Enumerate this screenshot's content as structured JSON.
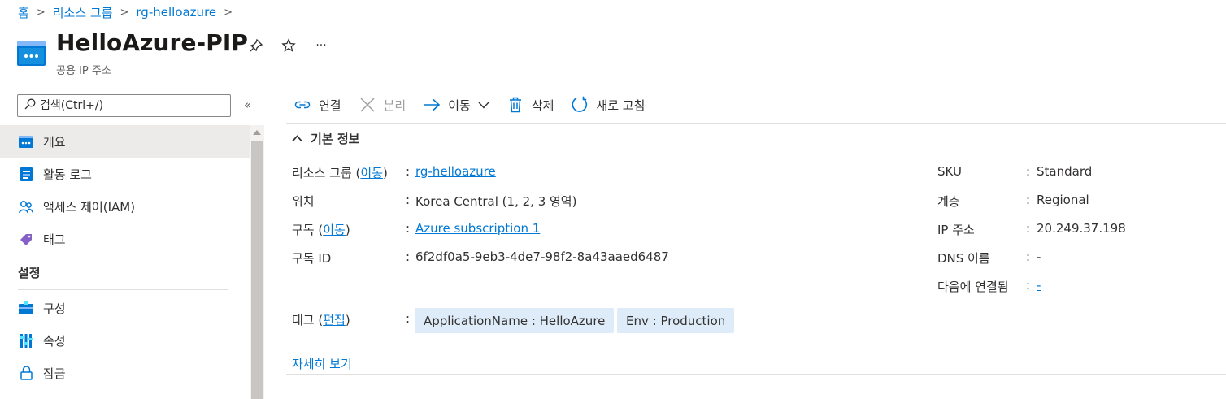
{
  "breadcrumb": [
    {
      "label": "홈"
    },
    {
      "label": "리소스 그룹"
    },
    {
      "label": "rg-helloazure"
    }
  ],
  "header": {
    "title": "HelloAzure-PIP",
    "subtitle": "공용 IP 주소",
    "more_label": "···"
  },
  "sidebar": {
    "search_placeholder": "검색(Ctrl+/)",
    "collapse_label": "«",
    "items": [
      {
        "label": "개요",
        "icon": "overview-icon"
      },
      {
        "label": "활동 로그",
        "icon": "activity-log-icon"
      },
      {
        "label": "액세스 제어(IAM)",
        "icon": "iam-icon"
      },
      {
        "label": "태그",
        "icon": "tag-icon"
      }
    ],
    "section_settings": "설정",
    "settings_items": [
      {
        "label": "구성",
        "icon": "configuration-icon"
      },
      {
        "label": "속성",
        "icon": "properties-icon"
      },
      {
        "label": "잠금",
        "icon": "lock-icon"
      }
    ]
  },
  "toolbar": {
    "associate": "연결",
    "dissociate": "분리",
    "move": "이동",
    "delete": "삭제",
    "refresh": "새로 고침"
  },
  "essentials": {
    "heading": "기본 정보",
    "left": {
      "resource_group": {
        "label": "리소스 그룹",
        "link_paren": "이동",
        "value": "rg-helloazure"
      },
      "location": {
        "label": "위치",
        "value": "Korea Central (1, 2, 3 영역)"
      },
      "subscription": {
        "label": "구독",
        "link_paren": "이동",
        "value": "Azure subscription 1"
      },
      "subscription_id": {
        "label": "구독 ID",
        "value": "6f2df0a5-9eb3-4de7-98f2-8a43aaed6487"
      }
    },
    "right": {
      "sku": {
        "label": "SKU",
        "value": "Standard"
      },
      "tier": {
        "label": "계층",
        "value": "Regional"
      },
      "ip_address": {
        "label": "IP 주소",
        "value": "20.249.37.198"
      },
      "dns_name": {
        "label": "DNS 이름",
        "value": "-"
      },
      "associated_to": {
        "label": "다음에 연결됨",
        "value": "-"
      }
    },
    "tags": {
      "label": "태그",
      "link_paren": "편집",
      "items": [
        "ApplicationName : HelloAzure",
        "Env : Production"
      ]
    },
    "see_more": "자세히 보기"
  },
  "colors": {
    "accent": "#0078d4",
    "tag_bg": "#deecf9",
    "nav_active_bg": "#edebe9"
  }
}
